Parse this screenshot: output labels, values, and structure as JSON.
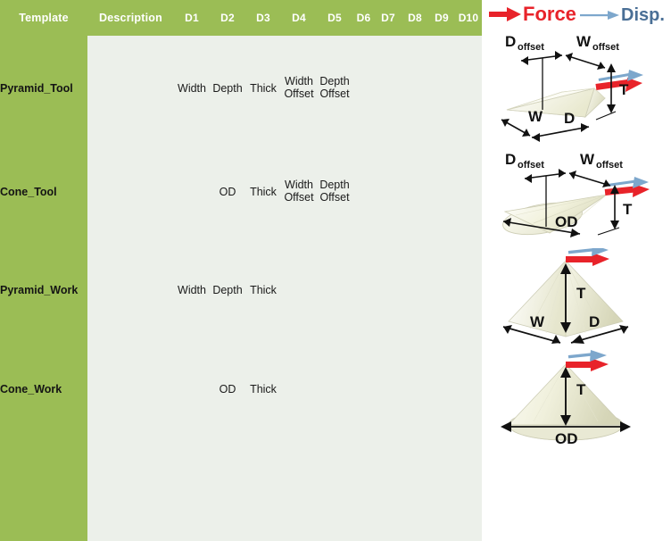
{
  "table": {
    "headers": [
      "Template",
      "Description",
      "D1",
      "D2",
      "D3",
      "D4",
      "D5",
      "D6",
      "D7",
      "D8",
      "D9",
      "D10"
    ],
    "rows": [
      {
        "template": "Pyramid_Tool",
        "description": "",
        "d1": "Width",
        "d2": "Depth",
        "d3": "Thick",
        "d4": "Width\nOffset",
        "d4_line1": "Width",
        "d4_line2": "Offset",
        "d5": "Depth\nOffset",
        "d5_line1": "Depth",
        "d5_line2": "Offset",
        "d6": "",
        "d7": "",
        "d8": "",
        "d9": "",
        "d10": ""
      },
      {
        "template": "Cone_Tool",
        "description": "",
        "d1": "",
        "d2": "OD",
        "d3": "Thick",
        "d4": "Width\nOffset",
        "d4_line1": "Width",
        "d4_line2": "Offset",
        "d5": "Depth\nOffset",
        "d5_line1": "Depth",
        "d5_line2": "Offset",
        "d6": "",
        "d7": "",
        "d8": "",
        "d9": "",
        "d10": ""
      },
      {
        "template": "Pyramid_Work",
        "description": "",
        "d1": "Width",
        "d2": "Depth",
        "d3": "Thick",
        "d4": "",
        "d4_line1": "",
        "d4_line2": "",
        "d5": "",
        "d5_line1": "",
        "d5_line2": "",
        "d6": "",
        "d7": "",
        "d8": "",
        "d9": "",
        "d10": ""
      },
      {
        "template": "Cone_Work",
        "description": "",
        "d1": "",
        "d2": "OD",
        "d3": "Thick",
        "d4": "",
        "d4_line1": "",
        "d4_line2": "",
        "d5": "",
        "d5_line1": "",
        "d5_line2": "",
        "d6": "",
        "d7": "",
        "d8": "",
        "d9": "",
        "d10": ""
      },
      {
        "template": "",
        "description": "",
        "d1": "",
        "d2": "",
        "d3": "",
        "d4": "",
        "d4_line1": "",
        "d4_line2": "",
        "d5": "",
        "d5_line1": "",
        "d5_line2": "",
        "d6": "",
        "d7": "",
        "d8": "",
        "d9": "",
        "d10": ""
      }
    ]
  },
  "legend": {
    "force_label": "Force",
    "force_color": "#e8232a",
    "disp_label": "Disp.",
    "disp_color": "#7da7cc",
    "disp_text_color": "#4a6f96"
  },
  "figures": [
    {
      "name": "pyramid-tool-figure",
      "shape": "inverted-pyramid",
      "labels": {
        "d_offset_base": "D",
        "d_offset_sub": "offset",
        "w_offset_base": "W",
        "w_offset_sub": "offset",
        "thickness": "T",
        "width": "W",
        "depth": "D"
      }
    },
    {
      "name": "cone-tool-figure",
      "shape": "inverted-cone",
      "labels": {
        "d_offset_base": "D",
        "d_offset_sub": "offset",
        "w_offset_base": "W",
        "w_offset_sub": "offset",
        "thickness": "T",
        "outer_diameter": "OD"
      }
    },
    {
      "name": "pyramid-work-figure",
      "shape": "upright-pyramid",
      "labels": {
        "thickness": "T",
        "width": "W",
        "depth": "D"
      }
    },
    {
      "name": "cone-work-figure",
      "shape": "upright-cone",
      "labels": {
        "thickness": "T",
        "outer_diameter": "OD"
      }
    }
  ],
  "colors": {
    "header_green": "#9bbd55",
    "cell_bg": "#ecf0ea",
    "grid_white": "#ffffff",
    "solid_fill": "#f2f2e4",
    "solid_edge": "#cfcfb8"
  }
}
